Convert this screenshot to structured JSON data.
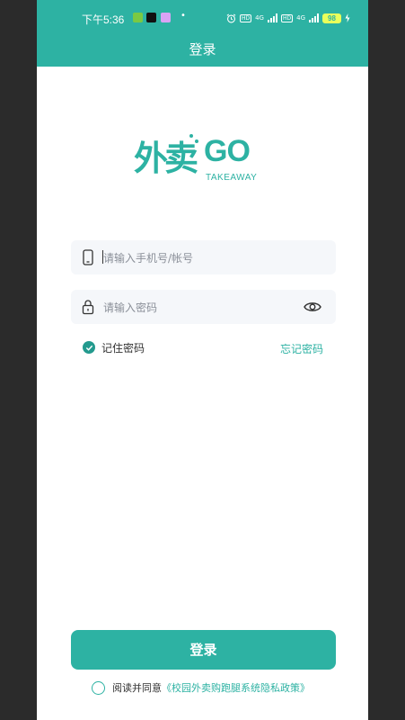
{
  "status_bar": {
    "time": "下午5:36",
    "network_1": "4G",
    "network_2": "4G",
    "battery": "98",
    "hd": "HD"
  },
  "navbar": {
    "title": "登录"
  },
  "logo": {
    "cn": "外卖",
    "go": "GO",
    "en": "TAKEAWAY"
  },
  "form": {
    "phone_placeholder": "请输入手机号/帐号",
    "password_placeholder": "请输入密码",
    "remember_label": "记住密码",
    "remember_checked": true,
    "forgot_label": "忘记密码"
  },
  "login_button": "登录",
  "agreement": {
    "prefix": "阅读并同意",
    "link": "《校园外卖购跑腿系统隐私政策》",
    "checked": false
  },
  "colors": {
    "primary": "#2db2a3",
    "input_bg": "#f5f7fa",
    "check": "#239a8e"
  }
}
